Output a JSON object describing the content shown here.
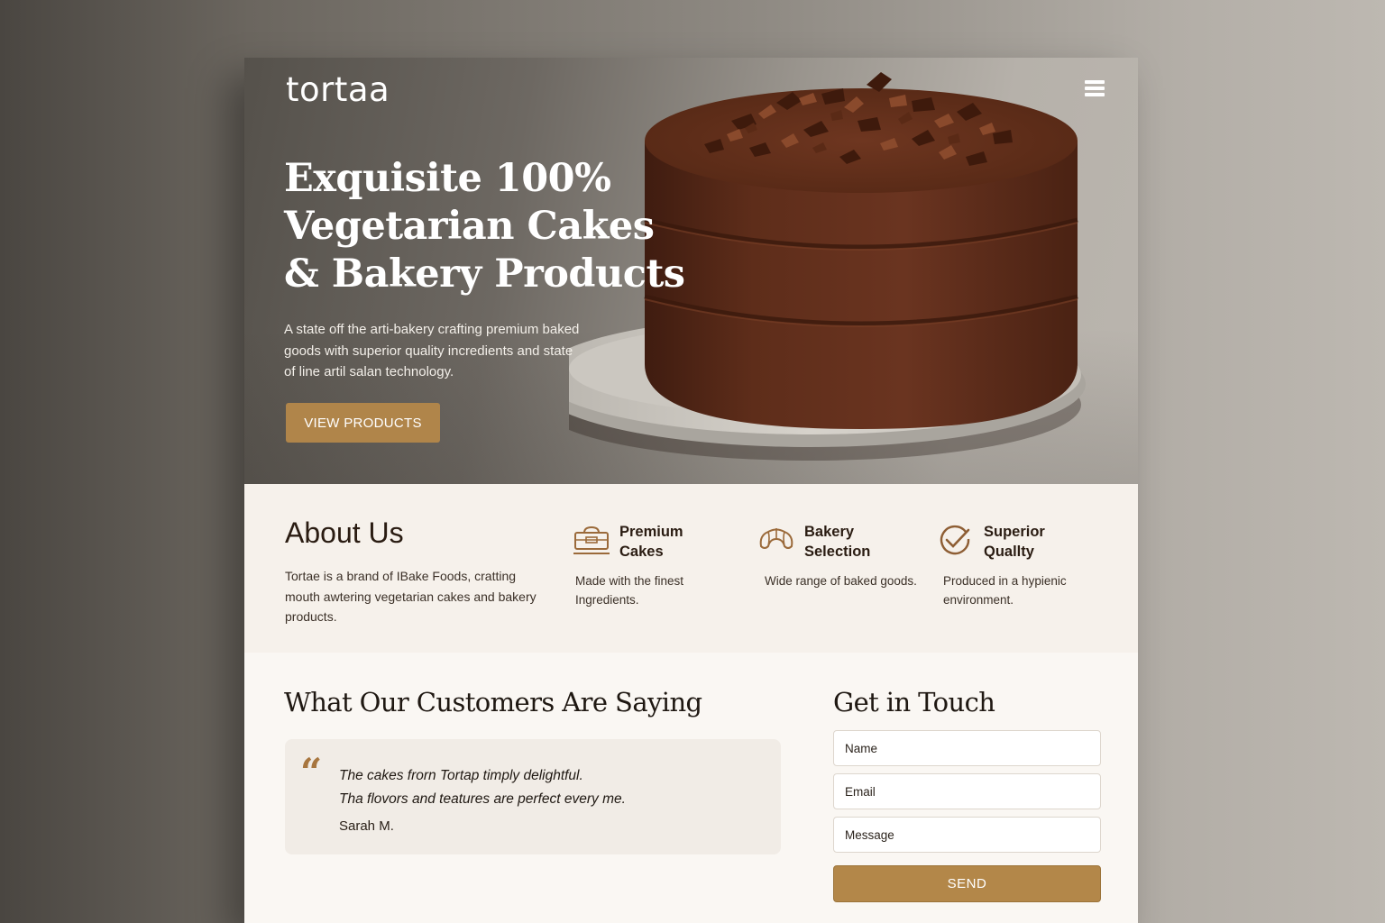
{
  "brand": {
    "logo": "tortaa"
  },
  "hero": {
    "title_lines": [
      "Exquisite 100%",
      "Vegetarian Cakes",
      "& Bakery Products"
    ],
    "subtitle": "A state off the arti-bakery crafting premium baked goods with superior quality incredients and state of line artil salan technology.",
    "cta_label": "VIEW PRODUCTS"
  },
  "about": {
    "heading": "About Us",
    "text": "Tortae is a brand of IBake Foods, cratting mouth awtering vegetarian cakes and bakery products.",
    "features": [
      {
        "icon": "cake-box-icon",
        "title_line1": "Premium",
        "title_line2": "Cakes",
        "text": "Made with the finest Ingredients."
      },
      {
        "icon": "croissant-icon",
        "title_line1": "Bakery",
        "title_line2": "Selection",
        "text": "Wide range of baked goods."
      },
      {
        "icon": "check-circle-icon",
        "title_line1": "Superior",
        "title_line2": "Quallty",
        "text": "Produced in a hypienic environment."
      }
    ]
  },
  "testimonials": {
    "heading": "What Our Customers Are Saying",
    "quote_mark": "“",
    "quote_line1": "The cakes frorn Tortap timply delightful.",
    "quote_line2": "Tha flovors and teatures are perfect every me.",
    "author": "Sarah M."
  },
  "contact": {
    "heading": "Get in Touch",
    "name_placeholder": "Name",
    "email_placeholder": "Email",
    "message_placeholder": "Message",
    "send_label": "SEND"
  },
  "colors": {
    "accent": "#b0854a",
    "dark_text": "#2a1c12",
    "chocolate": "#5a2e1c"
  }
}
